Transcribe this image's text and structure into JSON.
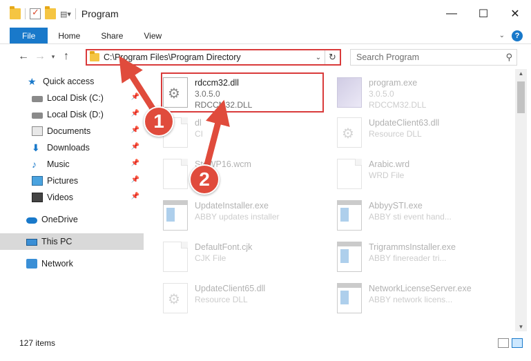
{
  "window": {
    "title": "Program"
  },
  "ribbon": {
    "tabs": [
      "File",
      "Home",
      "Share",
      "View"
    ],
    "help": "?"
  },
  "address": {
    "path": "C:\\Program Files\\Program Directory"
  },
  "search": {
    "placeholder": "Search Program"
  },
  "nav": {
    "items": [
      {
        "label": "Quick access"
      },
      {
        "label": "Local Disk (C:)"
      },
      {
        "label": "Local Disk (D:)"
      },
      {
        "label": "Documents"
      },
      {
        "label": "Downloads"
      },
      {
        "label": "Music"
      },
      {
        "label": "Pictures"
      },
      {
        "label": "Videos"
      },
      {
        "label": "OneDrive"
      },
      {
        "label": "This PC"
      },
      {
        "label": "Network"
      }
    ]
  },
  "files": [
    {
      "name": "rdccm32.dll",
      "line2": "3.0.5.0",
      "line3": "RDCCM32.DLL",
      "icon": "gear-dll-icon"
    },
    {
      "name": "program.exe",
      "line2": "3.0.5.0",
      "line3": "RDCCM32.DLL",
      "icon": "program-icon"
    },
    {
      "name": "dl",
      "line2": "CI",
      "icon": "page-icon"
    },
    {
      "name": "UpdateClient63.dll",
      "line2": "Resource DLL",
      "icon": "gear-dll-icon"
    },
    {
      "name": "StoWP16.wcm",
      "line2": "M File",
      "icon": "page-icon"
    },
    {
      "name": "Arabic.wrd",
      "line2": "WRD File",
      "icon": "page-icon"
    },
    {
      "name": "UpdateInstaller.exe",
      "line2": "ABBY updates installer",
      "icon": "exe-icon"
    },
    {
      "name": "AbbyySTI.exe",
      "line2": "ABBY sti event hand...",
      "icon": "exe-icon"
    },
    {
      "name": "DefaultFont.cjk",
      "line2": "CJK File",
      "icon": "page-icon"
    },
    {
      "name": "TrigrammsInstaller.exe",
      "line2": "ABBY finereader tri...",
      "icon": "exe-icon"
    },
    {
      "name": "UpdateClient65.dll",
      "line2": "Resource DLL",
      "icon": "gear-dll-icon"
    },
    {
      "name": "NetworkLicenseServer.exe",
      "line2": "ABBY network licens...",
      "icon": "exe-icon"
    }
  ],
  "status": {
    "items": "127 items"
  },
  "annotations": {
    "badge1": "1",
    "badge2": "2",
    "color": "#e04b3c"
  }
}
